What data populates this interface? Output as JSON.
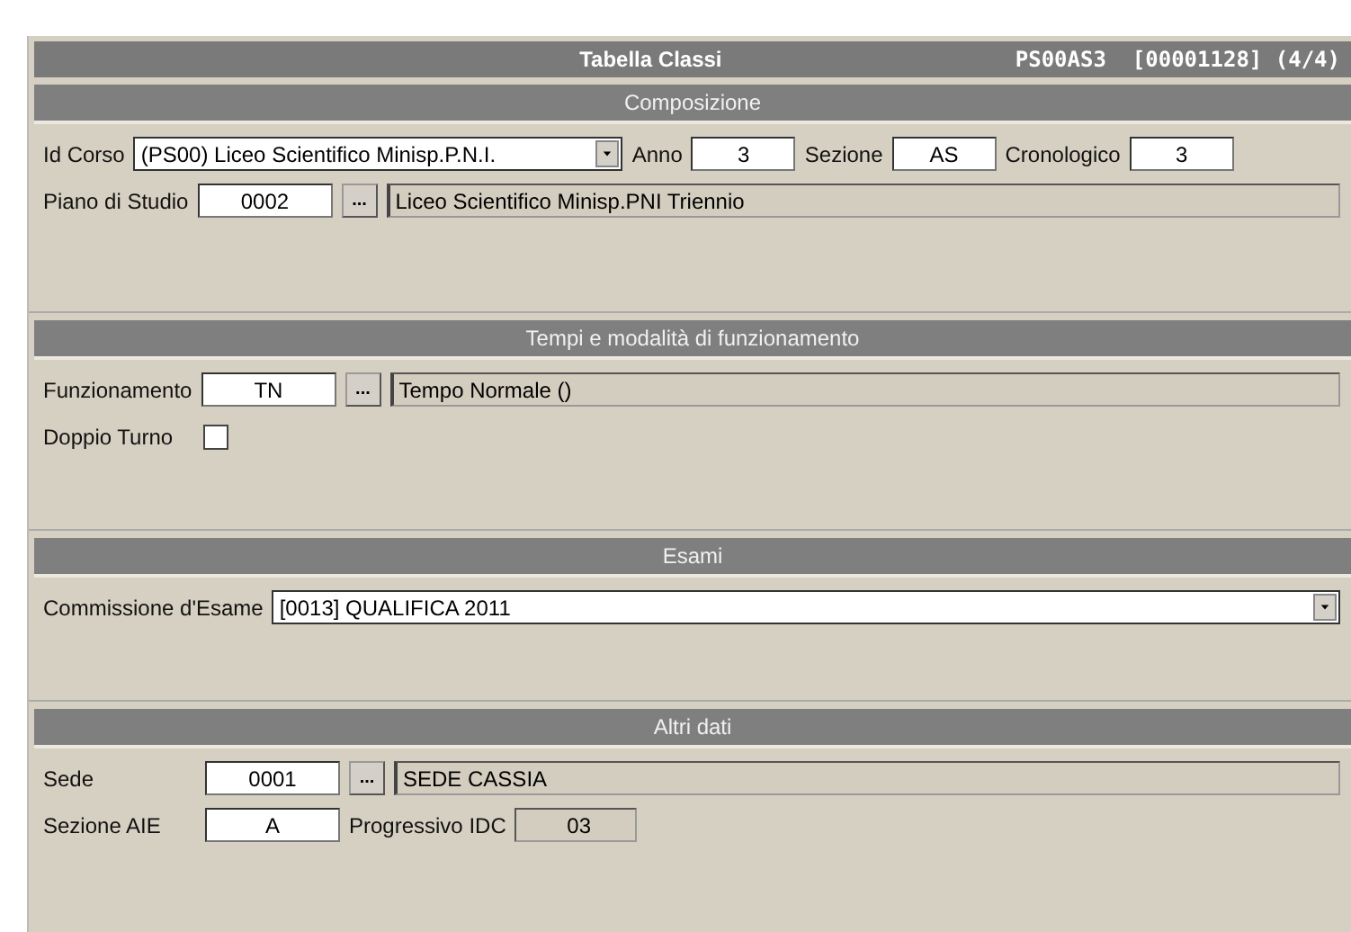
{
  "window": {
    "title": "Tabella Classi",
    "record": "PS00AS3  [00001128] (4/4)"
  },
  "sections": [
    {
      "title": "Composizione",
      "rows": [
        {
          "items": [
            {
              "kind": "label",
              "text": "Id Corso"
            },
            {
              "kind": "combo",
              "value": "(PS00) Liceo Scientifico Minisp.P.N.I."
            },
            {
              "kind": "label",
              "text": "Anno"
            },
            {
              "kind": "input",
              "value": "3"
            },
            {
              "kind": "label",
              "text": "Sezione"
            },
            {
              "kind": "input",
              "value": "AS"
            },
            {
              "kind": "label",
              "text": "Cronologico"
            },
            {
              "kind": "input",
              "value": "3"
            }
          ]
        },
        {
          "items": [
            {
              "kind": "label",
              "text": "Piano di Studio"
            },
            {
              "kind": "input",
              "value": "0002"
            },
            {
              "kind": "browse",
              "text": "..."
            },
            {
              "kind": "readonly",
              "value": "Liceo Scientifico Minisp.PNI Triennio"
            }
          ]
        }
      ]
    },
    {
      "title": "Tempi e modalità di funzionamento",
      "rows": [
        {
          "items": [
            {
              "kind": "label",
              "text": "Funzionamento"
            },
            {
              "kind": "input",
              "value": "TN"
            },
            {
              "kind": "browse",
              "text": "..."
            },
            {
              "kind": "readonly",
              "value": "Tempo Normale ()"
            }
          ]
        },
        {
          "items": [
            {
              "kind": "label",
              "text": "Doppio Turno"
            },
            {
              "kind": "checkbox",
              "checked": false
            }
          ]
        }
      ]
    },
    {
      "title": "Esami",
      "rows": [
        {
          "items": [
            {
              "kind": "label",
              "text": "Commissione d'Esame"
            },
            {
              "kind": "combo",
              "value": "[0013] QUALIFICA 2011"
            }
          ]
        }
      ]
    },
    {
      "title": "Altri dati",
      "rows": [
        {
          "items": [
            {
              "kind": "label",
              "text": "Sede"
            },
            {
              "kind": "input",
              "value": "0001"
            },
            {
              "kind": "browse",
              "text": "..."
            },
            {
              "kind": "readonly",
              "value": "SEDE  CASSIA"
            }
          ]
        },
        {
          "items": [
            {
              "kind": "label",
              "text": "Sezione AIE"
            },
            {
              "kind": "input",
              "value": "A"
            },
            {
              "kind": "label",
              "text": "Progressivo IDC"
            },
            {
              "kind": "readonly",
              "value": "03"
            }
          ]
        }
      ]
    }
  ]
}
